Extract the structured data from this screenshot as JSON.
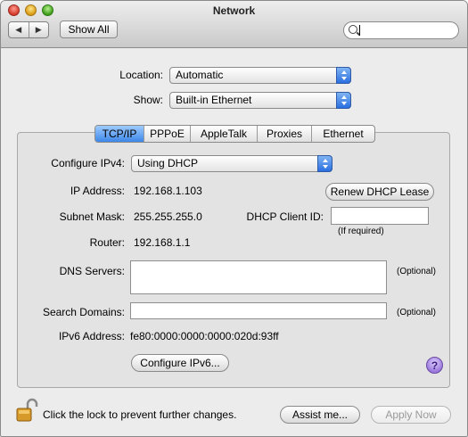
{
  "window": {
    "title": "Network"
  },
  "toolbar": {
    "show_all_label": "Show All",
    "search_value": ""
  },
  "location": {
    "label": "Location:",
    "value": "Automatic"
  },
  "show": {
    "label": "Show:",
    "value": "Built-in Ethernet"
  },
  "tabs": [
    {
      "label": "TCP/IP",
      "active": true
    },
    {
      "label": "PPPoE",
      "active": false
    },
    {
      "label": "AppleTalk",
      "active": false
    },
    {
      "label": "Proxies",
      "active": false
    },
    {
      "label": "Ethernet",
      "active": false
    }
  ],
  "tcpip": {
    "configure_label": "Configure IPv4:",
    "configure_value": "Using DHCP",
    "ip_label": "IP Address:",
    "ip_value": "192.168.1.103",
    "renew_button": "Renew DHCP Lease",
    "subnet_label": "Subnet Mask:",
    "subnet_value": "255.255.255.0",
    "dhcp_client_label": "DHCP Client ID:",
    "dhcp_client_value": "",
    "if_required": "(If required)",
    "router_label": "Router:",
    "router_value": "192.168.1.1",
    "dns_label": "DNS Servers:",
    "dns_value": "",
    "optional_1": "(Optional)",
    "search_label": "Search Domains:",
    "search_value": "",
    "optional_2": "(Optional)",
    "ipv6_label": "IPv6 Address:",
    "ipv6_value": "fe80:0000:0000:0000:020d:93ff",
    "configure_ipv6_button": "Configure IPv6...",
    "help_glyph": "?"
  },
  "footer": {
    "lock_text": "Click the lock to prevent further changes.",
    "assist_button": "Assist me...",
    "apply_button": "Apply Now"
  },
  "icons": {
    "lock": "unlocked-padlock-icon",
    "help": "help-icon",
    "search": "search-icon"
  },
  "colors": {
    "accent": "#3d87e8",
    "help": "#9a78dc"
  }
}
